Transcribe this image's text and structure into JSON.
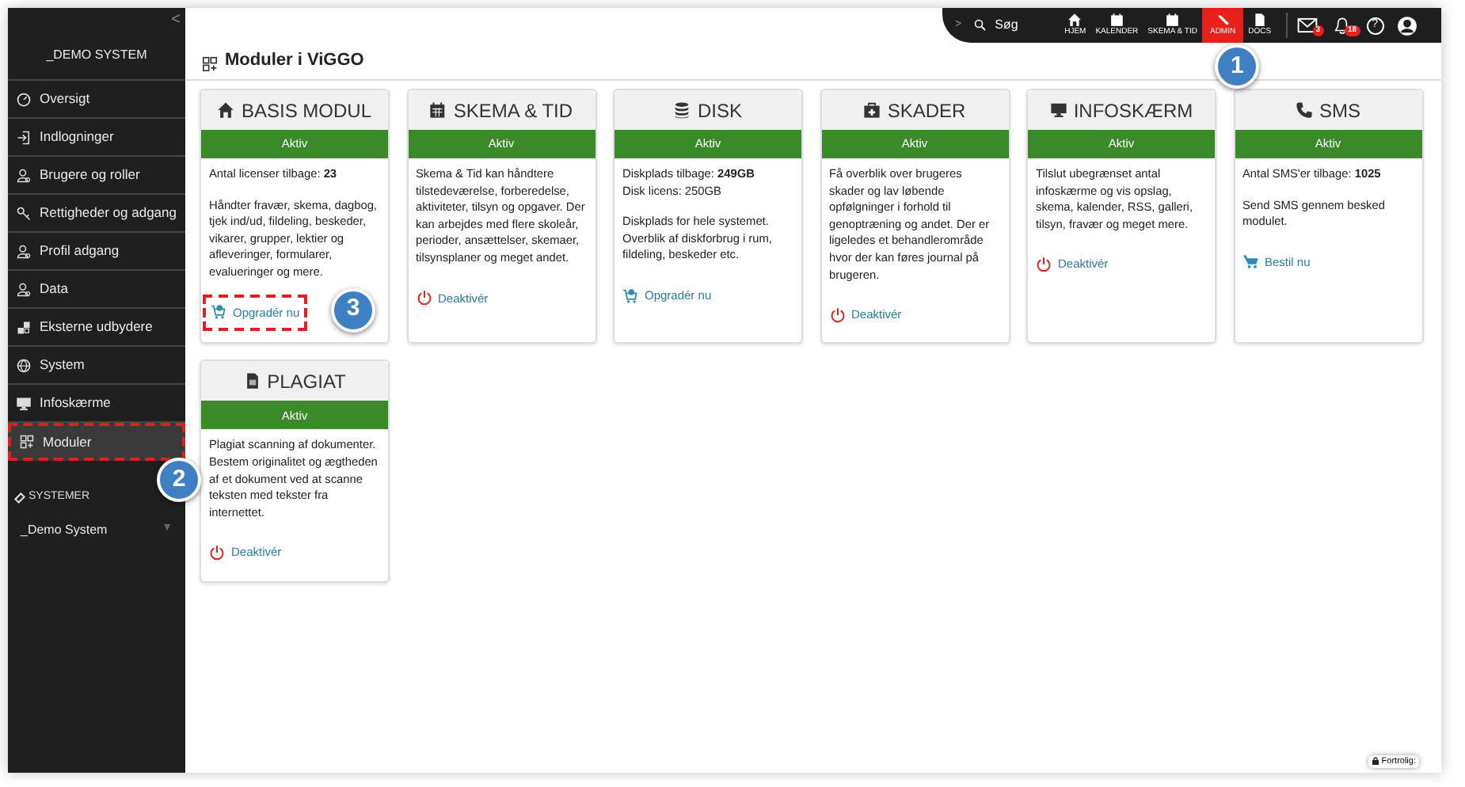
{
  "sidebar": {
    "collapse": "<",
    "org": "_DEMO SYSTEM",
    "items": [
      {
        "label": "Oversigt",
        "selected": false
      },
      {
        "label": "Indlogninger",
        "selected": false
      },
      {
        "label": "Brugere og roller",
        "selected": false
      },
      {
        "label": "Rettigheder og adgang",
        "selected": false
      },
      {
        "label": "Profil adgang",
        "selected": false
      },
      {
        "label": "Data",
        "selected": false
      },
      {
        "label": "Eksterne udbydere",
        "selected": false
      },
      {
        "label": "System",
        "selected": false
      },
      {
        "label": "Infoskærme",
        "selected": false
      },
      {
        "label": "Moduler",
        "selected": true,
        "callout": "2"
      }
    ],
    "systems_heading": "SYSTEMER",
    "system": "_Demo System",
    "system_caret": "▼"
  },
  "topbar": {
    "expand": ">",
    "search": "Søg",
    "nav": [
      {
        "label": "HJEM",
        "selected": false
      },
      {
        "label": "KALENDER",
        "selected": false
      },
      {
        "label": "SKEMA & TID",
        "selected": false
      },
      {
        "label": "ADMIN",
        "selected": true,
        "callout": "1"
      },
      {
        "label": "DOCS",
        "selected": false
      }
    ],
    "mail_count": "3",
    "bell_count": "18",
    "help": "?"
  },
  "page_title": "Moduler i ViGGO",
  "cards": [
    {
      "title": "BASIS MODUL",
      "status": "Aktiv",
      "paragraphs": [
        "Antal licenser tilbage: **23**",
        "Håndter fravær, skema, dagbog, tjek ind/ud, fildeling, beskeder, vikarer, grupper, lektier og afleveringer, formularer, evalueringer og mere."
      ],
      "action": {
        "kind": "upgrade",
        "label": "Opgradér nu",
        "callout": "3"
      }
    },
    {
      "title": "SKEMA & TID",
      "status": "Aktiv",
      "paragraphs": [
        "Skema & Tid kan håndtere tilstedeværelse, forberedelse, aktiviteter, tilsyn og opgaver. Der kan arbejdes med flere skoleår, perioder, ansættelser, skemaer, tilsynsplaner og meget andet."
      ],
      "action": {
        "kind": "deactivate",
        "label": "Deaktivér"
      }
    },
    {
      "title": "DISK",
      "status": "Aktiv",
      "paragraphs": [
        "Diskplads tilbage: **249GB**\nDisk licens: 250GB",
        "Diskplads for hele systemet. Overblik af diskforbrug i rum, fildeling, beskeder etc."
      ],
      "action": {
        "kind": "upgrade",
        "label": "Opgradér nu"
      }
    },
    {
      "title": "SKADER",
      "status": "Aktiv",
      "paragraphs": [
        "Få overblik over brugeres skader og lav løbende opfølgninger i forhold til genoptræning og andet. Der er ligeledes et behandlerområde hvor der kan føres journal på brugeren."
      ],
      "action": {
        "kind": "deactivate",
        "label": "Deaktivér"
      }
    },
    {
      "title": "INFOSKÆRM",
      "status": "Aktiv",
      "paragraphs": [
        "Tilslut ubegrænset antal infoskærme og vis opslag, skema, kalender, RSS, galleri, tilsyn, fravær og meget mere."
      ],
      "action": {
        "kind": "deactivate",
        "label": "Deaktivér"
      }
    },
    {
      "title": "SMS",
      "status": "Aktiv",
      "paragraphs": [
        "Antal SMS'er tilbage: **1025**",
        "Send SMS gennem besked modulet."
      ],
      "action": {
        "kind": "order",
        "label": "Bestil nu"
      }
    },
    {
      "title": "PLAGIAT",
      "status": "Aktiv",
      "paragraphs": [
        "Plagiat scanning af dokumenter. Bestem originalitet og ægtheden af et dokument ved at scanne teksten med tekster fra internettet."
      ],
      "action": {
        "kind": "deactivate",
        "label": "Deaktivér"
      }
    }
  ],
  "confidential": "Fortrolig:"
}
